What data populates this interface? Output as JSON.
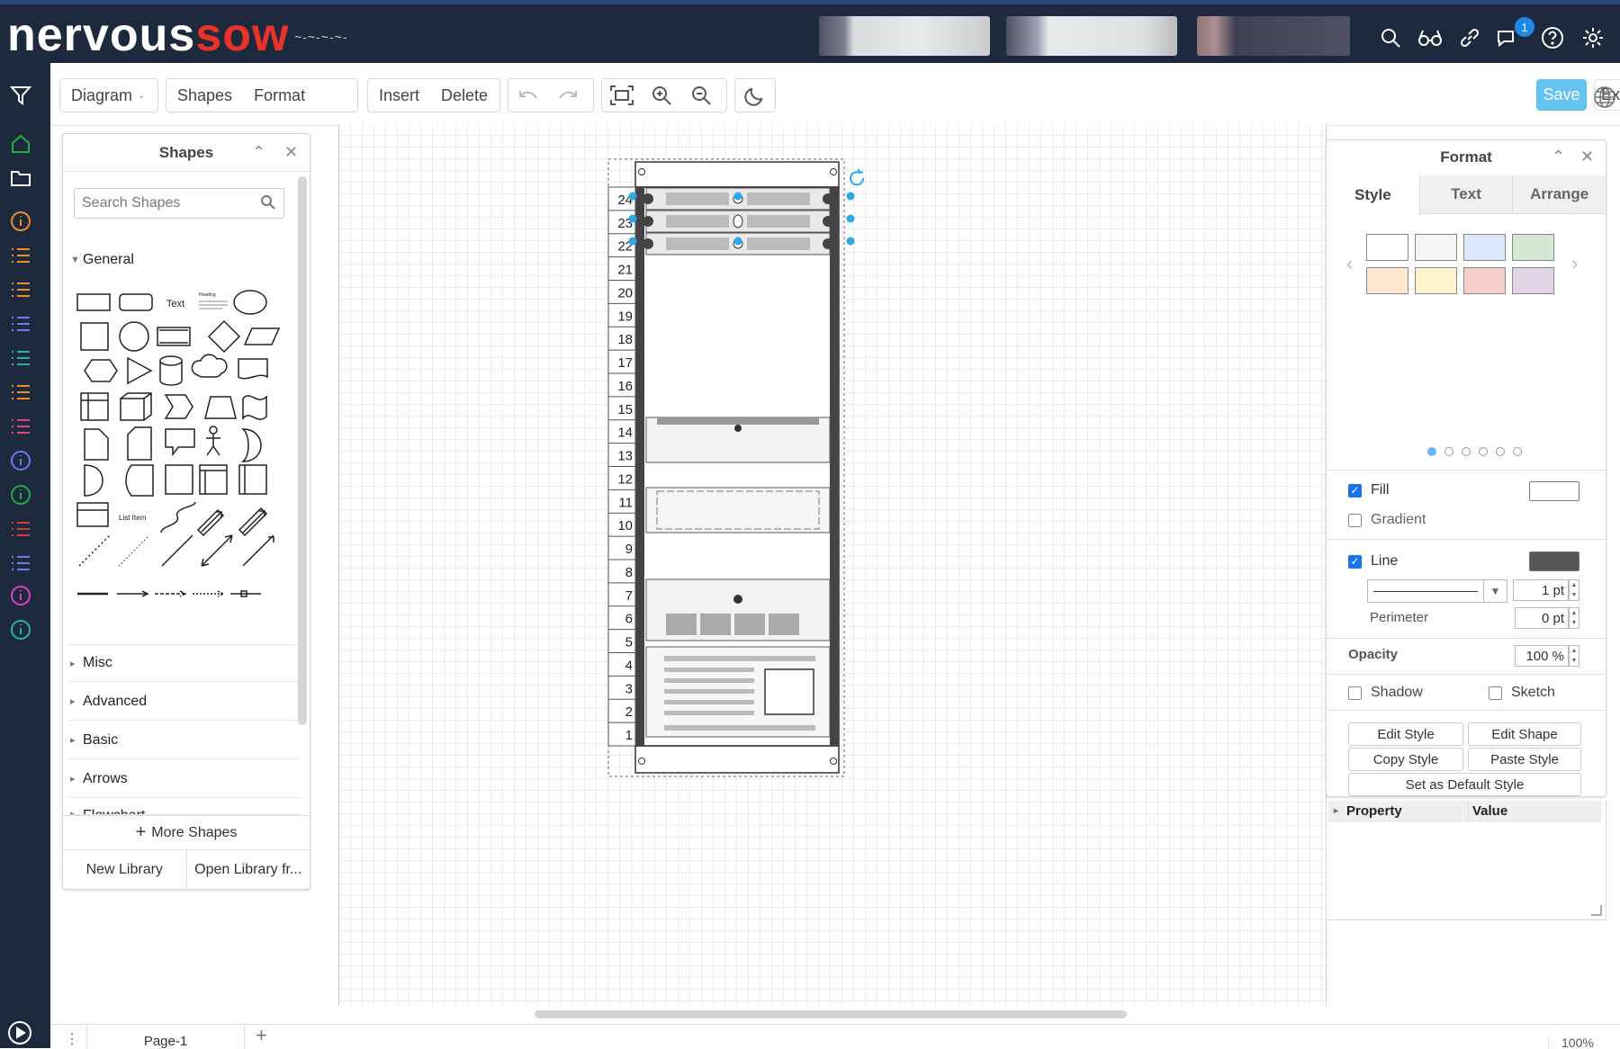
{
  "app": {
    "logo_left": "nervous",
    "logo_right": "sow",
    "logo_sub": "~-~-~-~-"
  },
  "topbar": {
    "notification_count": "1"
  },
  "toolbar": {
    "diagram_label": "Diagram",
    "shapes_label": "Shapes",
    "format_label": "Format",
    "insert_label": "Insert",
    "delete_label": "Delete",
    "save_label": "Save",
    "exit_label": "Exit"
  },
  "shapes_panel": {
    "title": "Shapes",
    "search_placeholder": "Search Shapes",
    "sections": [
      "General",
      "Misc",
      "Advanced",
      "Basic",
      "Arrows",
      "Flowchart"
    ],
    "shape_text_label": "Text",
    "shape_heading_label": "Heading",
    "shape_list_item_label": "List Item",
    "more_shapes": "More Shapes",
    "new_library": "New Library",
    "open_library": "Open Library fr..."
  },
  "rack": {
    "units": [
      "24",
      "23",
      "22",
      "21",
      "20",
      "19",
      "18",
      "17",
      "16",
      "15",
      "14",
      "13",
      "12",
      "11",
      "10",
      "9",
      "8",
      "7",
      "6",
      "5",
      "4",
      "3",
      "2",
      "1"
    ]
  },
  "format_panel": {
    "title": "Format",
    "tabs": [
      "Style",
      "Text",
      "Arrange"
    ],
    "fill_label": "Fill",
    "gradient_label": "Gradient",
    "line_label": "Line",
    "line_width": "1 pt",
    "perimeter_label": "Perimeter",
    "perimeter_value": "0 pt",
    "opacity_label": "Opacity",
    "opacity_value": "100 %",
    "shadow_label": "Shadow",
    "sketch_label": "Sketch",
    "edit_style": "Edit Style",
    "edit_shape": "Edit Shape",
    "copy_style": "Copy Style",
    "paste_style": "Paste Style",
    "set_default_style": "Set as Default Style",
    "property_header": "Property",
    "value_header": "Value",
    "swatches": [
      "#ffffff",
      "#f5f5f5",
      "#dae8fc",
      "#d5e8d4",
      "#ffe6cc",
      "#fff2cc",
      "#f8cecc",
      "#e1d5e7"
    ],
    "fill_color": "#ffffff",
    "line_color": "#555555"
  },
  "bottom": {
    "page_tab": "Page-1",
    "zoom": "100%"
  }
}
